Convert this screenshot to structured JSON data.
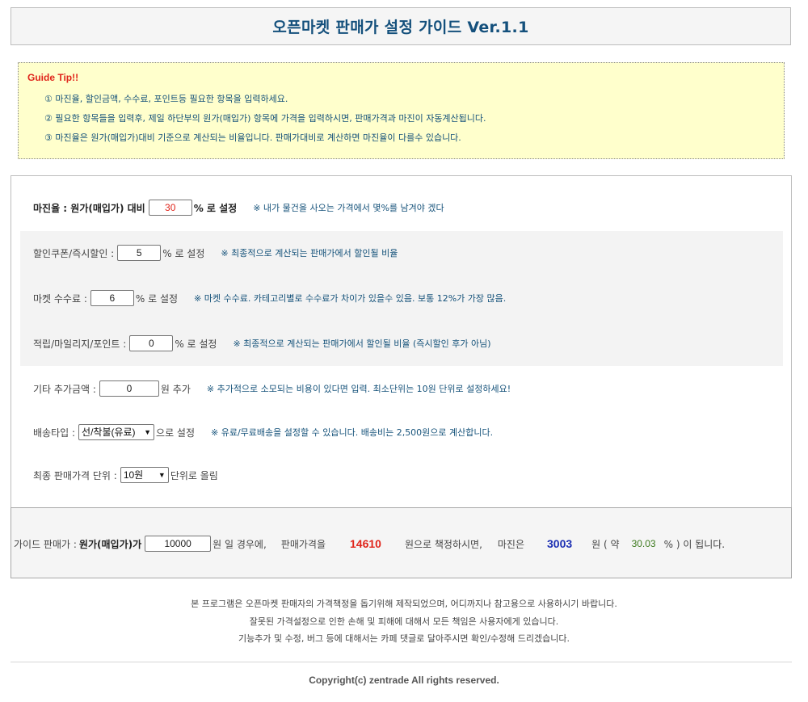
{
  "header": {
    "title": "오픈마켓 판매가 설정 가이드 Ver.1.1"
  },
  "tip": {
    "title": "Guide Tip!!",
    "lines": [
      "① 마진율, 할인금액, 수수료, 포인트등 필요한 항목을 입력하세요.",
      "② 필요한 항목들을 입력후, 제일 하단부의 원가(매입가) 항목에 가격을 입력하시면, 판매가격과 마진이 자동계산됩니다.",
      "③ 마진율은 원가(매입가)대비 기준으로 계산되는 비율입니다. 판매가대비로 계산하면 마진율이 다를수 있습니다."
    ]
  },
  "form": {
    "margin": {
      "label": "마진율 : 원가(매입가) 대비",
      "value": "30",
      "unit": "% 로 설정",
      "note": "※ 내가 물건을 사오는 가격에서 몇%를 남겨야 겠다"
    },
    "coupon": {
      "label": "할인쿠폰/즉시할인 :",
      "value": "5",
      "unit": "% 로 설정",
      "note": "※ 최종적으로 계산되는 판매가에서 할인될 비율"
    },
    "fee": {
      "label": "마켓 수수료 :",
      "value": "6",
      "unit": "% 로 설정",
      "note": "※ 마켓 수수료. 카테고리별로 수수료가 차이가 있을수 있음. 보통 12%가 가장 많음."
    },
    "point": {
      "label": "적립/마일리지/포인트 :",
      "value": "0",
      "unit": "% 로 설정",
      "note": "※ 최종적으로 계산되는 판매가에서 할인될 비율 (즉시할인 후가 아님)"
    },
    "extra": {
      "label": "기타 추가금액 :",
      "value": "0",
      "unit": "원 추가",
      "note": "※ 추가적으로 소모되는 비용이 있다면 입력. 최소단위는 10원 단위로 설정하세요!"
    },
    "shipping": {
      "label": "배송타입 :",
      "selected": "선/착불(유료)",
      "unit": "으로 설정",
      "note": "※ 유료/무료배송을 설정할 수 있습니다. 배송비는 2,500원으로 계산합니다."
    },
    "rounding": {
      "label": "최종 판매가격 단위 :",
      "selected": "10원",
      "unit": "단위로 올림"
    }
  },
  "result": {
    "prefix": "가이드 판매가 :",
    "cost_label": "원가(매입가)가",
    "cost_value": "10000",
    "cost_suffix": "원 일 경우에,",
    "price_label": "판매가격을",
    "price_value": "14610",
    "price_suffix": "원으로 책정하시면,",
    "margin_label": "마진은",
    "margin_value": "3003",
    "margin_mid": "원 ( 약",
    "rate_value": "30.03",
    "rate_suffix": "% ) 이 됩니다."
  },
  "footer": {
    "lines": [
      "본 프로그램은 오픈마켓 판매자의 가격책정을 돕기위해 제작되었으며, 어디까지나 참고용으로 사용하시기 바랍니다.",
      "잘못된 가격설정으로 인한 손해 및 피해에 대해서 모든 책임은 사용자에게 있습니다.",
      "기능추가 및 수정, 버그 등에 대해서는 카페 댓글로 달아주시면 확인/수정해 드리겠습니다."
    ],
    "copyright": "Copyright(c) zentrade All rights reserved."
  },
  "colors": {
    "title": "#14507c",
    "tip_bg": "#ffffcc",
    "tip_title": "#e0251b",
    "note": "#15527a",
    "price": "#e0251b",
    "margin": "#1c2fb3",
    "rate": "#3d7a1e"
  }
}
